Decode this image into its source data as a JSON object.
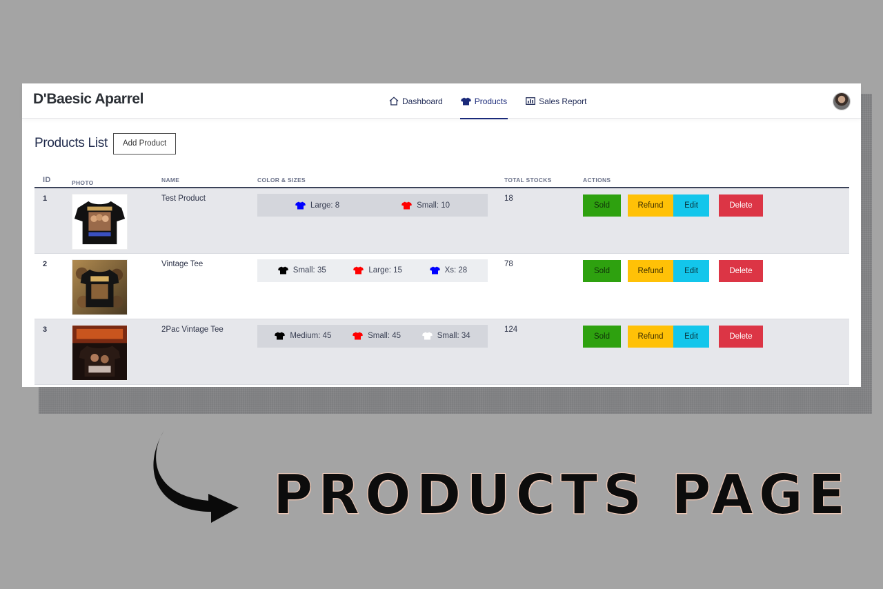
{
  "app": {
    "brand": "D'Baesic Aparrel",
    "nav": [
      {
        "label": "Dashboard",
        "icon": "home-icon",
        "active": false
      },
      {
        "label": "Products",
        "icon": "tshirt-icon",
        "active": true
      },
      {
        "label": "Sales Report",
        "icon": "report-icon",
        "active": false
      }
    ],
    "avatar_icon": "user-avatar"
  },
  "page": {
    "title": "Products List",
    "add_button": "Add Product"
  },
  "table": {
    "headers": [
      "ID",
      "PHOTO",
      "NAME",
      "COLOR & SIZES",
      "TOTAL STOCKS",
      "ACTIONS"
    ],
    "rows": [
      {
        "id": "1",
        "name": "Test Product",
        "variants": [
          {
            "color": "#0000ff",
            "label": "Large: 8"
          },
          {
            "color": "#ff0000",
            "label": "Small: 10"
          }
        ],
        "total": "18"
      },
      {
        "id": "2",
        "name": "Vintage Tee",
        "variants": [
          {
            "color": "#000000",
            "label": "Small: 35"
          },
          {
            "color": "#ff0000",
            "label": "Large: 15"
          },
          {
            "color": "#0000ff",
            "label": "Xs: 28"
          }
        ],
        "total": "78"
      },
      {
        "id": "3",
        "name": "2Pac Vintage Tee",
        "variants": [
          {
            "color": "#000000",
            "label": "Medium: 45"
          },
          {
            "color": "#ff0000",
            "label": "Small: 45"
          },
          {
            "color": "#ffffff",
            "label": "Small: 34"
          }
        ],
        "total": "124"
      }
    ],
    "actions": {
      "sold": "Sold",
      "refund": "Refund",
      "edit": "Edit",
      "delete": "Delete"
    }
  },
  "caption": "PRODUCTS PAGE",
  "colors": {
    "sold": "#2ea10f",
    "refund": "#ffc107",
    "edit": "#13c6eb",
    "delete": "#dc3545",
    "nav_active": "#1a2a7a"
  }
}
